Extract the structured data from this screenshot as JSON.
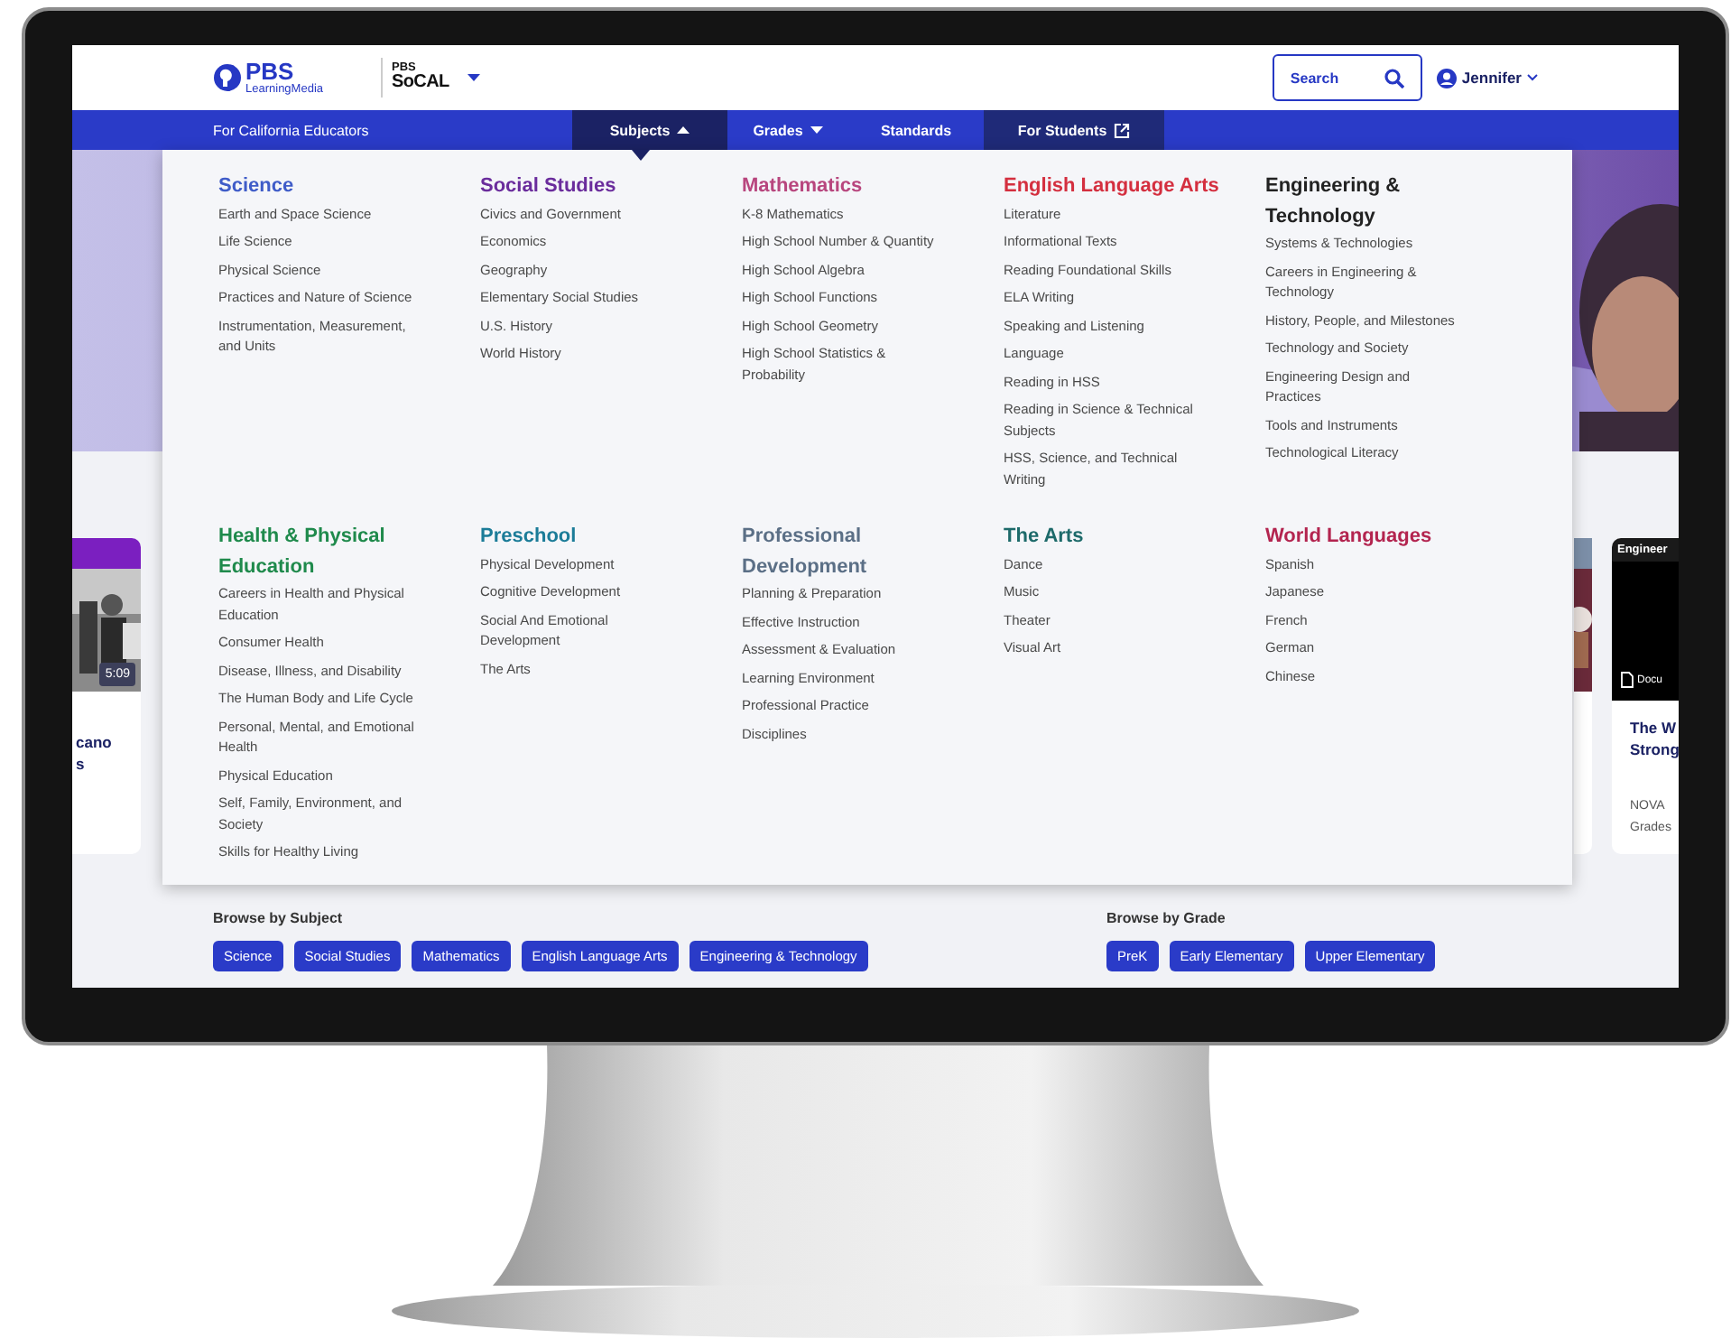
{
  "header": {
    "logo": {
      "brand": "PBS",
      "sub": "LearningMedia"
    },
    "station": {
      "line1": "PBS",
      "line2": "SoCAL"
    },
    "search": {
      "label": "Search"
    },
    "user": {
      "name": "Jennifer"
    }
  },
  "nav": {
    "region": "For California Educators",
    "items": [
      {
        "label": "Subjects",
        "kind": "dropdown",
        "selected": true,
        "expanded": true
      },
      {
        "label": "Grades",
        "kind": "dropdown",
        "selected": false,
        "expanded": false
      },
      {
        "label": "Standards",
        "kind": "link",
        "selected": false
      },
      {
        "label": "For Students",
        "kind": "external",
        "selected": false
      }
    ]
  },
  "subjects_menu": {
    "groups": [
      {
        "title": "Science",
        "color": "#3f5cc8",
        "items": [
          "Earth and Space Science",
          "Life Science",
          "Physical Science",
          "Practices and Nature of Science",
          "Instrumentation, Measurement, and Units"
        ]
      },
      {
        "title": "Social Studies",
        "color": "#6a2c9c",
        "items": [
          "Civics and Government",
          "Economics",
          "Geography",
          "Elementary Social Studies",
          "U.S. History",
          "World History"
        ]
      },
      {
        "title": "Mathematics",
        "color": "#b8467e",
        "items": [
          "K-8 Mathematics",
          "High School Number & Quantity",
          "High School Algebra",
          "High School Functions",
          "High School Geometry",
          "High School Statistics & Probability"
        ]
      },
      {
        "title": "English Language Arts",
        "color": "#d42f3f",
        "items": [
          "Literature",
          "Informational Texts",
          "Reading Foundational Skills",
          "ELA Writing",
          "Speaking and Listening",
          "Language",
          "Reading in HSS",
          "Reading in Science & Technical Subjects",
          "HSS, Science, and Technical Writing"
        ]
      },
      {
        "title": "Engineering & Technology",
        "color": "#222222",
        "items": [
          "Systems & Technologies",
          "Careers in Engineering & Technology",
          "History, People, and Milestones",
          "Technology and Society",
          "Engineering Design and Practices",
          "Tools and Instruments",
          "Technological Literacy"
        ]
      },
      {
        "title": "Health & Physical Education",
        "color": "#1f8a4c",
        "items": [
          "Careers in Health and Physical Education",
          "Consumer Health",
          "Disease, Illness, and Disability",
          "The Human Body and Life Cycle",
          "Personal, Mental, and Emotional Health",
          "Physical Education",
          "Self, Family, Environment, and Society",
          "Skills for Healthy Living"
        ]
      },
      {
        "title": "Preschool",
        "color": "#1b7c98",
        "items": [
          "Physical Development",
          "Cognitive Development",
          "Social And Emotional Development",
          "The Arts"
        ]
      },
      {
        "title": "Professional Development",
        "color": "#5b6f86",
        "items": [
          "Planning & Preparation",
          "Effective Instruction",
          "Assessment & Evaluation",
          "Learning Environment",
          "Professional Practice",
          "Disciplines"
        ]
      },
      {
        "title": "The Arts",
        "color": "#1d6a6a",
        "items": [
          "Dance",
          "Music",
          "Theater",
          "Visual Art"
        ]
      },
      {
        "title": "World Languages",
        "color": "#b3244f",
        "items": [
          "Spanish",
          "Japanese",
          "French",
          "German",
          "Chinese"
        ]
      }
    ]
  },
  "left_card": {
    "duration": "5:09",
    "title_lines": [
      "cano",
      "s"
    ]
  },
  "right_card": {
    "tag": "Engineer",
    "type": "Docu",
    "title_lines": [
      "The W",
      "Strong"
    ],
    "source": "NOVA",
    "grades": "Grades"
  },
  "browse": [
    {
      "heading": "Browse by Subject",
      "chips": [
        "Science",
        "Social Studies",
        "Mathematics",
        "English Language Arts",
        "Engineering & Technology"
      ]
    },
    {
      "heading": "Browse by Grade",
      "chips": [
        "PreK",
        "Early Elementary",
        "Upper Elementary"
      ]
    }
  ]
}
